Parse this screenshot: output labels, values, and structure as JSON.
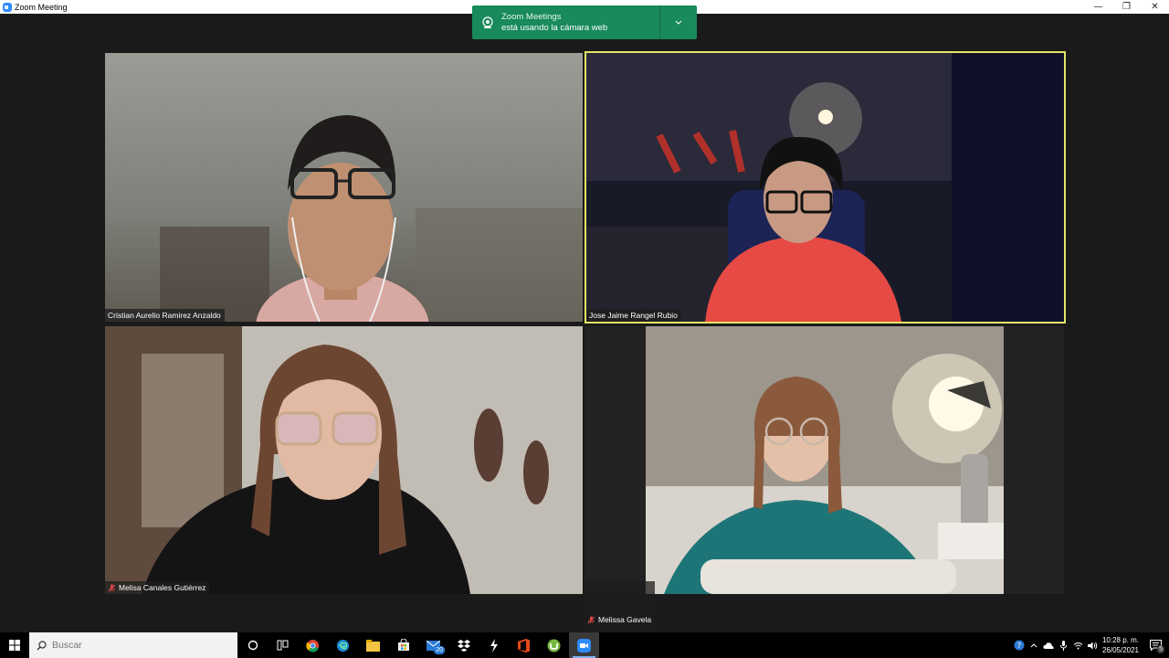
{
  "window": {
    "title": "Zoom Meeting",
    "minimize": "—",
    "restore": "❐",
    "close": "✕"
  },
  "toast": {
    "title": "Zoom Meetings",
    "message": "está usando la cámara web",
    "expand": "⌄"
  },
  "participants": [
    {
      "name": "Cristian Aurelio Ramirez Anzaldo",
      "muted": false,
      "active_speaker": false
    },
    {
      "name": "Jose Jaime Rangel Rubio",
      "muted": false,
      "active_speaker": true
    },
    {
      "name": "Melisa Canales Gutiérrez",
      "muted": true,
      "active_speaker": false
    },
    {
      "name": "Melissa Gavela",
      "muted": true,
      "active_speaker": false
    }
  ],
  "taskbar": {
    "search_placeholder": "Buscar",
    "mail_badge": "20",
    "clock_time": "10:28 p. m.",
    "clock_date": "26/05/2021",
    "notification_count": "5",
    "apps": [
      "cortana-icon",
      "task-view-icon",
      "chrome-icon",
      "edge-icon",
      "file-explorer-icon",
      "store-icon",
      "mail-icon",
      "dropbox-icon",
      "winamp-icon",
      "office-icon",
      "utorrent-icon",
      "zoom-icon"
    ]
  },
  "colors": {
    "toast_bg": "#188a5c",
    "active_speaker_border": "#e4e567",
    "taskbar_bg": "#000000"
  }
}
